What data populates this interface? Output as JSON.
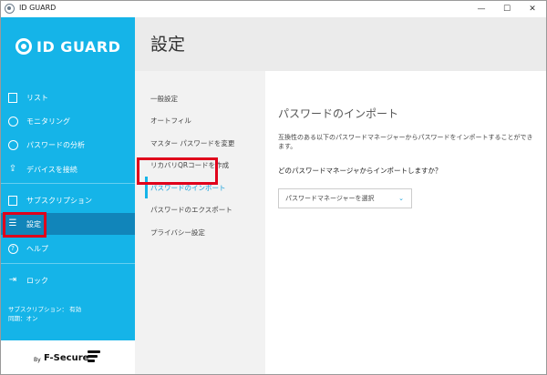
{
  "window": {
    "title": "ID GUARD",
    "controls": {
      "minimize": "—",
      "maximize": "☐",
      "close": "✕"
    }
  },
  "sidebar": {
    "logo": "ID GUARD",
    "items": [
      {
        "label": "リスト",
        "icon": "list-icon"
      },
      {
        "label": "モニタリング",
        "icon": "monitoring-icon"
      },
      {
        "label": "パスワードの分析",
        "icon": "clock-icon"
      },
      {
        "label": "デバイスを接続",
        "icon": "connect-device-icon"
      },
      {
        "label": "サブスクリプション",
        "icon": "subscription-icon"
      },
      {
        "label": "設定",
        "icon": "settings-sliders-icon"
      },
      {
        "label": "ヘルプ",
        "icon": "help-icon"
      },
      {
        "label": "ロック",
        "icon": "lock-icon"
      }
    ],
    "status_subscription": "サブスクリプション： 有効",
    "status_sync": "同期：オン",
    "footer_by": "By",
    "footer_brand": "F-Secure"
  },
  "main": {
    "page_title": "設定",
    "settings_items": [
      "一般設定",
      "オートフィル",
      "マスター パスワードを変更",
      "リカバリQRコードを作成",
      "パスワードのインポート",
      "パスワードのエクスポート",
      "プライバシー設定"
    ],
    "active_settings_index": 4,
    "content": {
      "heading": "パスワードのインポート",
      "description": "互換性のある以下のパスワードマネージャーからパスワードをインポートすることができます。",
      "question": "どのパスワードマネージャからインポートしますか？",
      "dropdown_placeholder": "パスワードマネージャーを選択",
      "dropdown_chevron": "⌄"
    }
  },
  "colors": {
    "sidebar_bg": "#15b4e8",
    "sidebar_active": "#1185ba",
    "accent": "#15a0db",
    "highlight": "#e0001b"
  }
}
